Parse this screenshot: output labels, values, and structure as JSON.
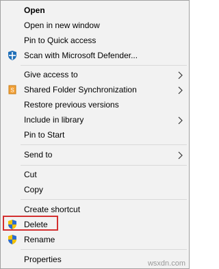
{
  "menu": {
    "items": [
      {
        "label": "Open"
      },
      {
        "label": "Open in new window"
      },
      {
        "label": "Pin to Quick access"
      },
      {
        "label": "Scan with Microsoft Defender...",
        "icon": "defender-shield-icon"
      },
      {
        "label": "Give access to"
      },
      {
        "label": "Shared Folder Synchronization",
        "icon": "sync-folder-icon"
      },
      {
        "label": "Restore previous versions"
      },
      {
        "label": "Include in library"
      },
      {
        "label": "Pin to Start"
      },
      {
        "label": "Send to"
      },
      {
        "label": "Cut"
      },
      {
        "label": "Copy"
      },
      {
        "label": "Create shortcut"
      },
      {
        "label": "Delete",
        "icon": "uac-shield-icon",
        "highlighted": true
      },
      {
        "label": "Rename",
        "icon": "uac-shield-icon"
      },
      {
        "label": "Properties"
      }
    ]
  },
  "watermark": "wsxdn.com",
  "colors": {
    "menu_bg": "#f2f2f2",
    "border": "#a0a0a0",
    "highlight": "#d32f2f"
  }
}
